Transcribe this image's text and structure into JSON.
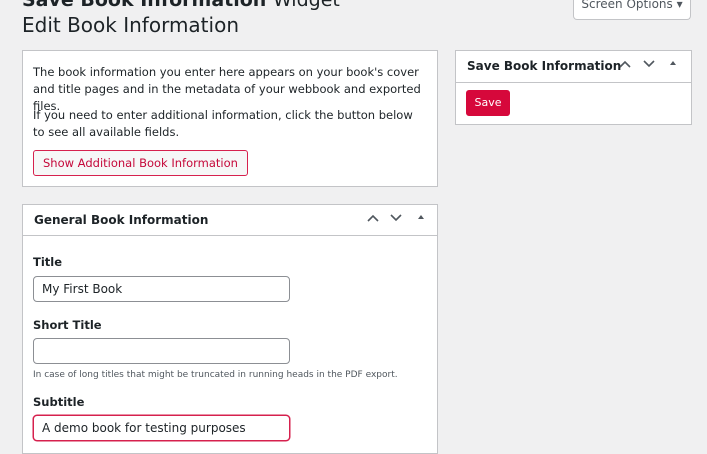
{
  "header_cut": {
    "bold": "Save Book Information",
    "rest": "Widget"
  },
  "screen_options_label": "Screen Options ▾",
  "page_title": "Edit Book Information",
  "intro": {
    "p1": "The book information you enter here appears on your book's cover and title pages and in the metadata of your webbook and exported files.",
    "p2": "If you need to enter additional information, click the button below to see all available fields.",
    "button_label": "Show Additional Book Information"
  },
  "save_box": {
    "title": "Save Book Information",
    "save_label": "Save"
  },
  "general_box": {
    "title": "General Book Information",
    "fields": [
      {
        "label": "Title",
        "value": "My First Book",
        "help": ""
      },
      {
        "label": "Short Title",
        "value": "",
        "help": "In case of long titles that might be truncated in running heads in the PDF export."
      },
      {
        "label": "Subtitle",
        "value": "A demo book for testing purposes",
        "help": ""
      }
    ]
  },
  "controls": {
    "up": "^",
    "down": "v",
    "toggle": "▲"
  },
  "colors": {
    "accent": "#d6083b",
    "background": "#f0f0f1",
    "border": "#c3c4c7"
  }
}
